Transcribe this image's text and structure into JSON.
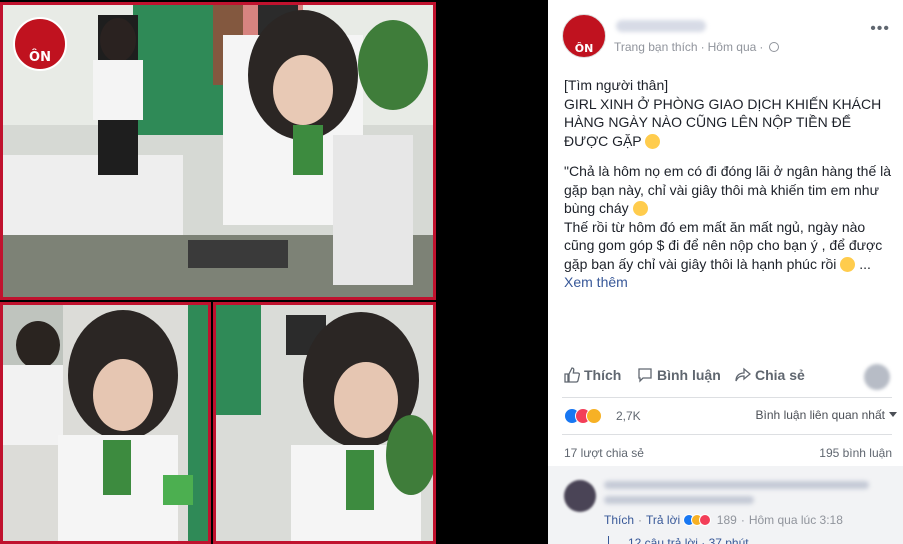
{
  "logo": {
    "text": "ÔN"
  },
  "post": {
    "meta": {
      "liked_by": "Trang bạn thích",
      "time": "Hôm qua",
      "more_icon": "more-options-icon"
    },
    "text": {
      "tag": "[Tìm người thân]",
      "headline": "GIRL XINH Ở PHÒNG GIAO DỊCH KHIẾN KHÁCH HÀNG NGÀY NÀO CŨNG LÊN NỘP TIỀN ĐỂ ĐƯỢC GẶP",
      "para1": "\"Chả là hôm nọ em có đi đóng lãi ở ngân hàng thế là gặp bạn này, chỉ vài giây thôi mà khiến tim em như bùng cháy",
      "para2": "Thế rồi từ hôm đó em mất ăn mất ngủ, ngày nào cũng gom góp $ đi để nên nộp cho bạn ý , để được gặp bạn ấy chỉ vài giây thôi là hạnh phúc rồi",
      "ellipsis": "...",
      "see_more": "Xem thêm"
    },
    "actions": {
      "like": "Thích",
      "comment": "Bình luận",
      "share": "Chia sẻ"
    },
    "reactions": {
      "count": "2,7K",
      "sort_label": "Bình luận liên quan nhất"
    },
    "stats": {
      "shares": "17 lượt chia sẻ",
      "comments": "195 bình luận"
    },
    "comment": {
      "like": "Thích",
      "reply": "Trả lời",
      "reaction_count": "189",
      "time": "Hôm qua lúc 3:18",
      "replies": "12 câu trả lời · 37 phút"
    }
  },
  "colors": {
    "accent": "#385898",
    "brand_red": "#c0121f",
    "meta_gray": "#90949c"
  }
}
